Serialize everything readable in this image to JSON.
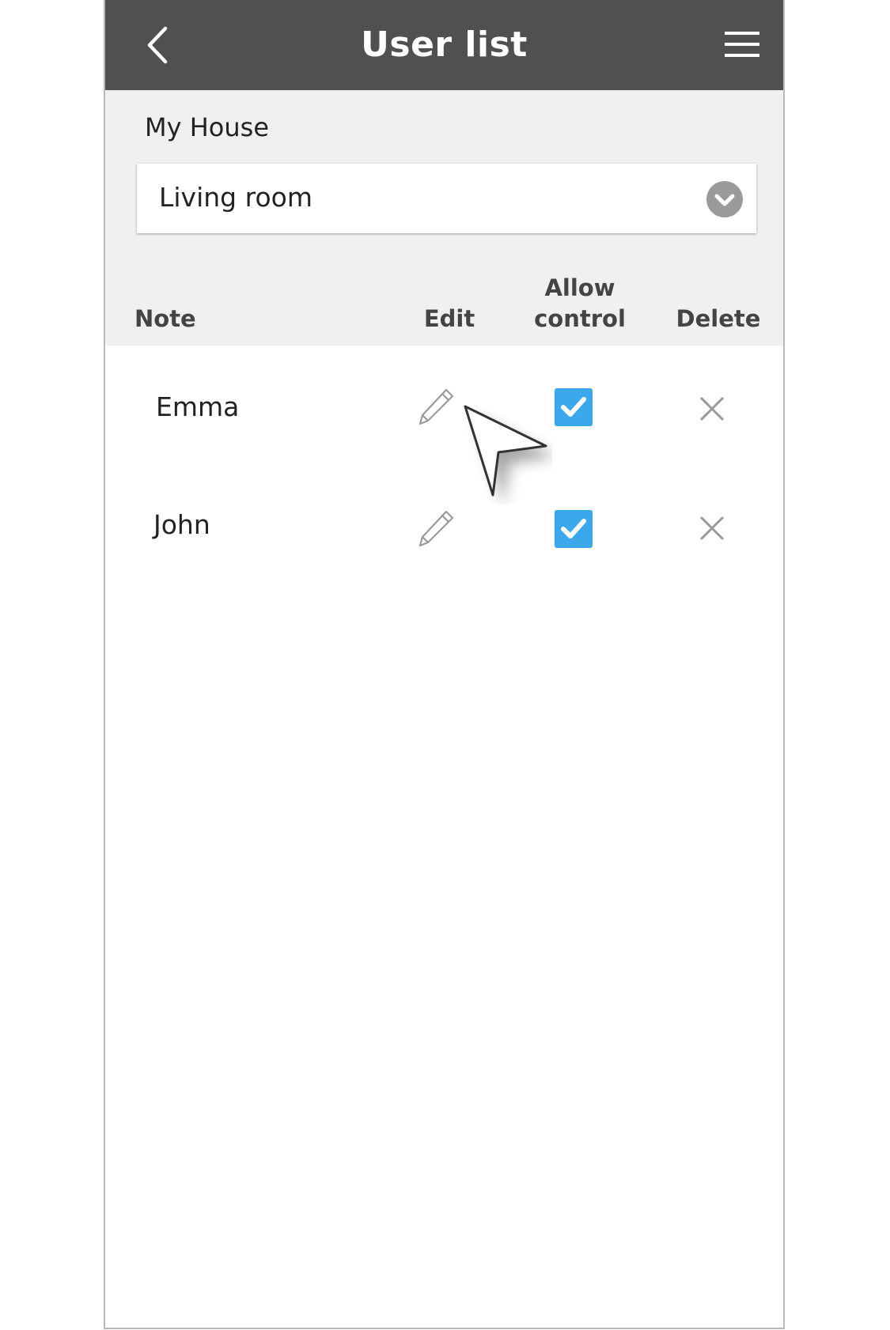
{
  "header": {
    "title": "User list",
    "back_icon": "chevron-left-icon",
    "menu_icon": "hamburger-menu-icon"
  },
  "house": {
    "label": "My House"
  },
  "room_select": {
    "value": "Living room",
    "icon": "chevron-down-circle-icon"
  },
  "table": {
    "columns": {
      "note": "Note",
      "edit": "Edit",
      "allow_line1": "Allow",
      "allow_line2": "control",
      "delete": "Delete"
    },
    "rows": [
      {
        "name": "Emma",
        "allow_control": true
      },
      {
        "name": "John",
        "allow_control": true
      }
    ]
  },
  "colors": {
    "header_bg": "#505050",
    "panel_bg": "#f0f0f0",
    "checkbox": "#3aa8ea",
    "icon_gray": "#9a9a9a"
  }
}
